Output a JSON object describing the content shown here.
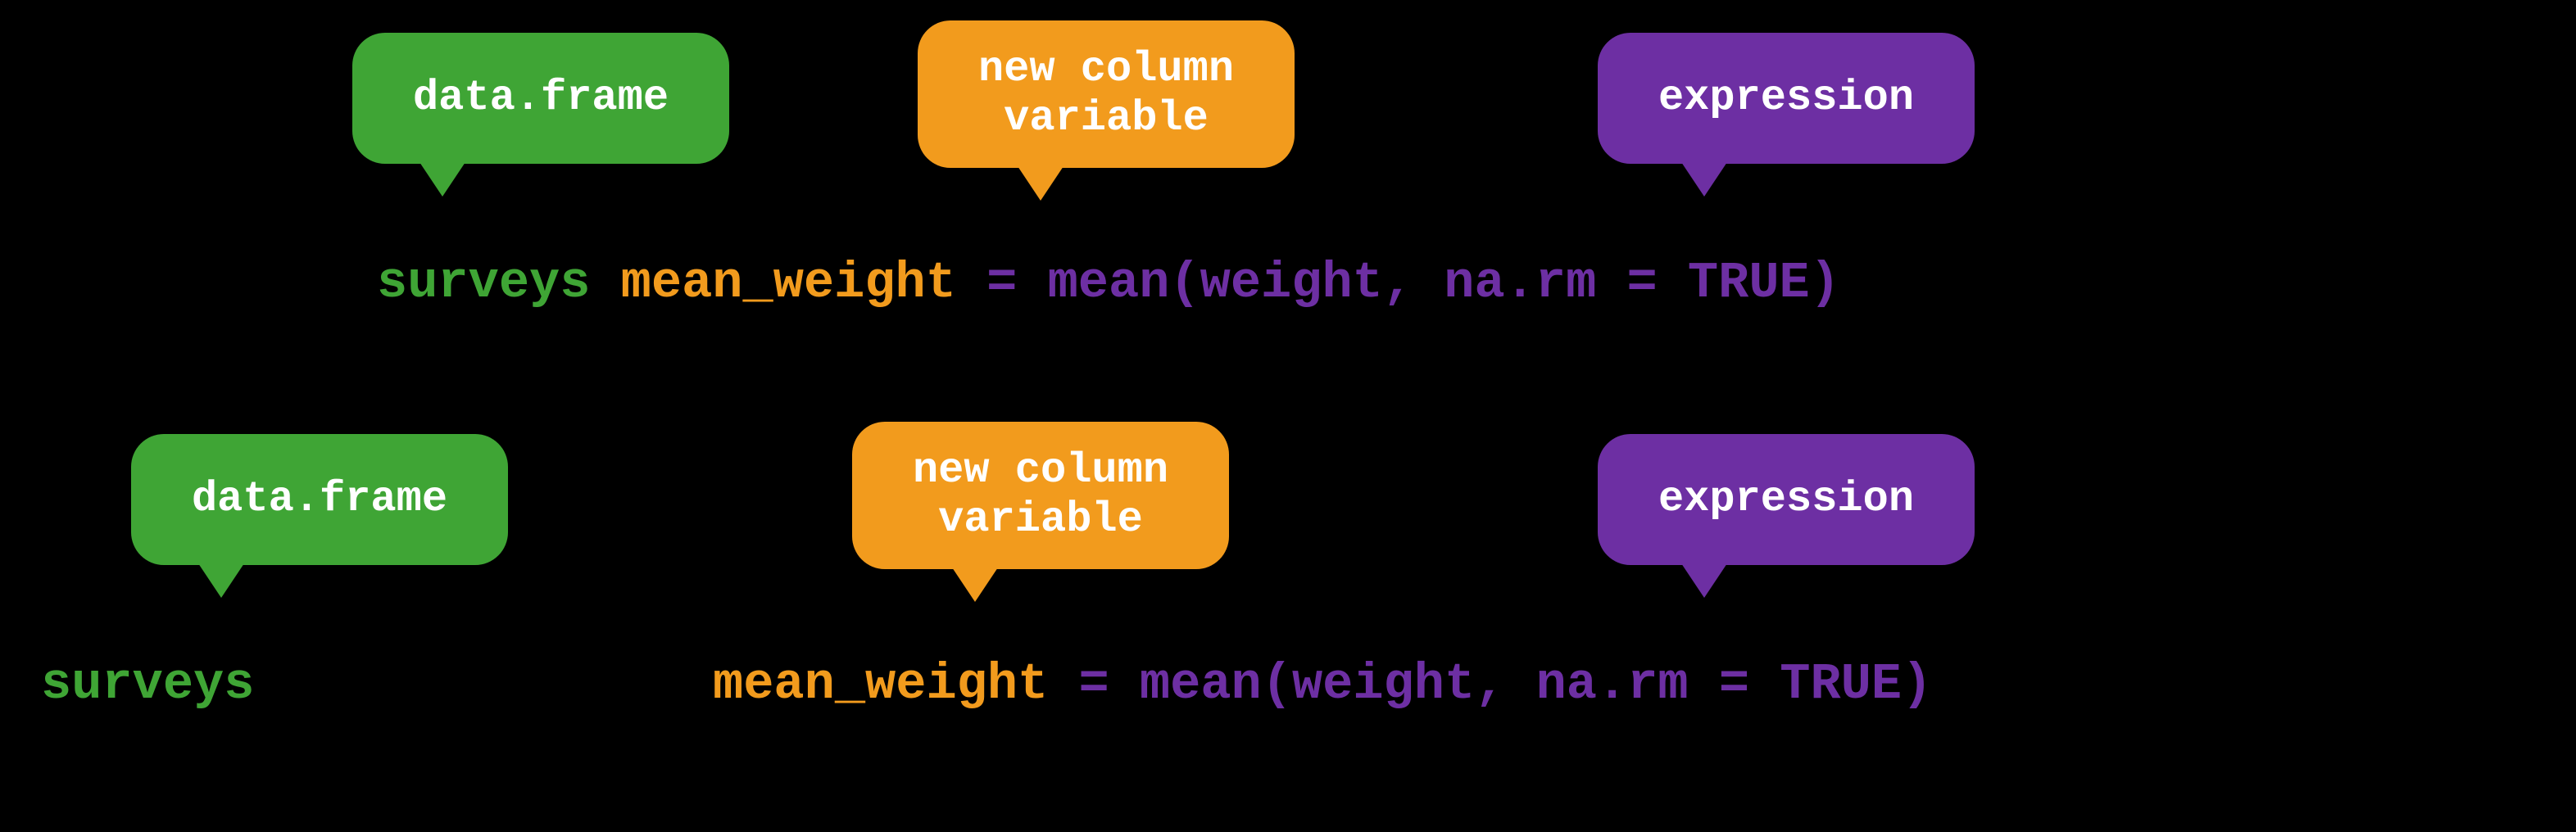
{
  "colors": {
    "green": "#3fa535",
    "orange": "#f29b1d",
    "purple": "#6d2fa3",
    "background": "#000000",
    "text_on_bubble": "#ffffff"
  },
  "labels": {
    "data_frame": "data.frame",
    "new_column": "new column\nvariable",
    "expression": "expression"
  },
  "code_tokens": {
    "surveys": "surveys",
    "mean_weight": "mean_weight",
    "expr": "= mean(weight, na.rm = TRUE)"
  },
  "rows": [
    {
      "bubbles": [
        {
          "role": "data_frame",
          "color": "green"
        },
        {
          "role": "new_column",
          "color": "orange"
        },
        {
          "role": "expression",
          "color": "purple"
        }
      ],
      "code_segments": [
        {
          "token": "surveys",
          "color": "green"
        },
        {
          "token": "mean_weight",
          "color": "orange"
        },
        {
          "token": "= mean(weight, na.rm = TRUE)",
          "color": "purple"
        }
      ]
    },
    {
      "bubbles": [
        {
          "role": "data_frame",
          "color": "green"
        },
        {
          "role": "new_column",
          "color": "orange"
        },
        {
          "role": "expression",
          "color": "purple"
        }
      ],
      "code_segments": [
        {
          "token": "surveys",
          "color": "green"
        },
        {
          "token": "mean_weight",
          "color": "orange"
        },
        {
          "token": "= mean(weight, na.rm = TRUE)",
          "color": "purple"
        }
      ]
    }
  ]
}
